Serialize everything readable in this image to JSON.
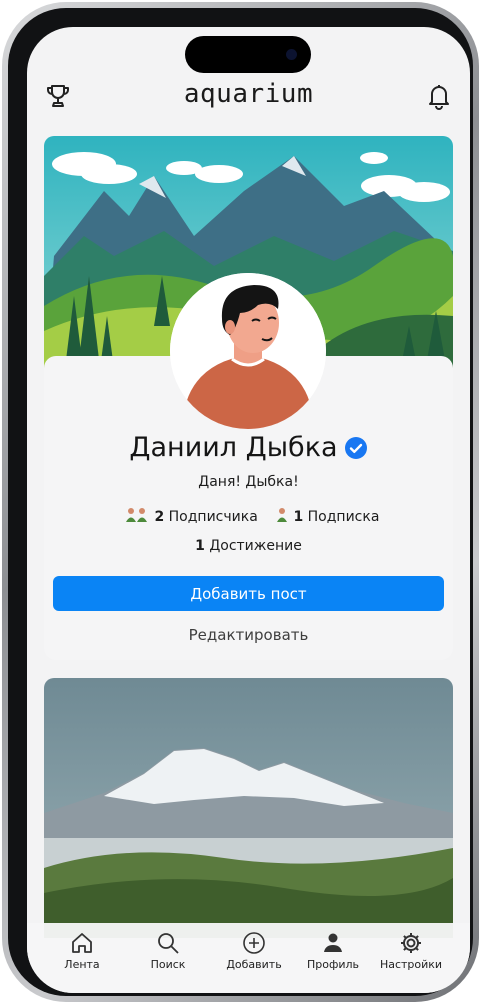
{
  "app": {
    "title": "aquarium"
  },
  "header": {
    "trophy_icon": "trophy-icon",
    "bell_icon": "bell-icon"
  },
  "profile": {
    "name": "Даниил Дыбка",
    "status": "Даня! Дыбка!",
    "followers_count": "2",
    "followers_label": "Подписчика",
    "following_count": "1",
    "following_label": "Подписка",
    "achievements_count": "1",
    "achievements_label": "Достижение",
    "add_post_label": "Добавить пост",
    "edit_label": "Редактировать"
  },
  "colors": {
    "accent": "#0a84f5",
    "verified": "#1877f2"
  },
  "tabbar": {
    "items": [
      {
        "label": "Лента",
        "icon": "home-icon"
      },
      {
        "label": "Поиск",
        "icon": "search-icon"
      },
      {
        "label": "Добавить",
        "icon": "add-circle-icon"
      },
      {
        "label": "Профиль",
        "icon": "person-icon"
      },
      {
        "label": "Настройки",
        "icon": "gear-icon"
      }
    ]
  }
}
